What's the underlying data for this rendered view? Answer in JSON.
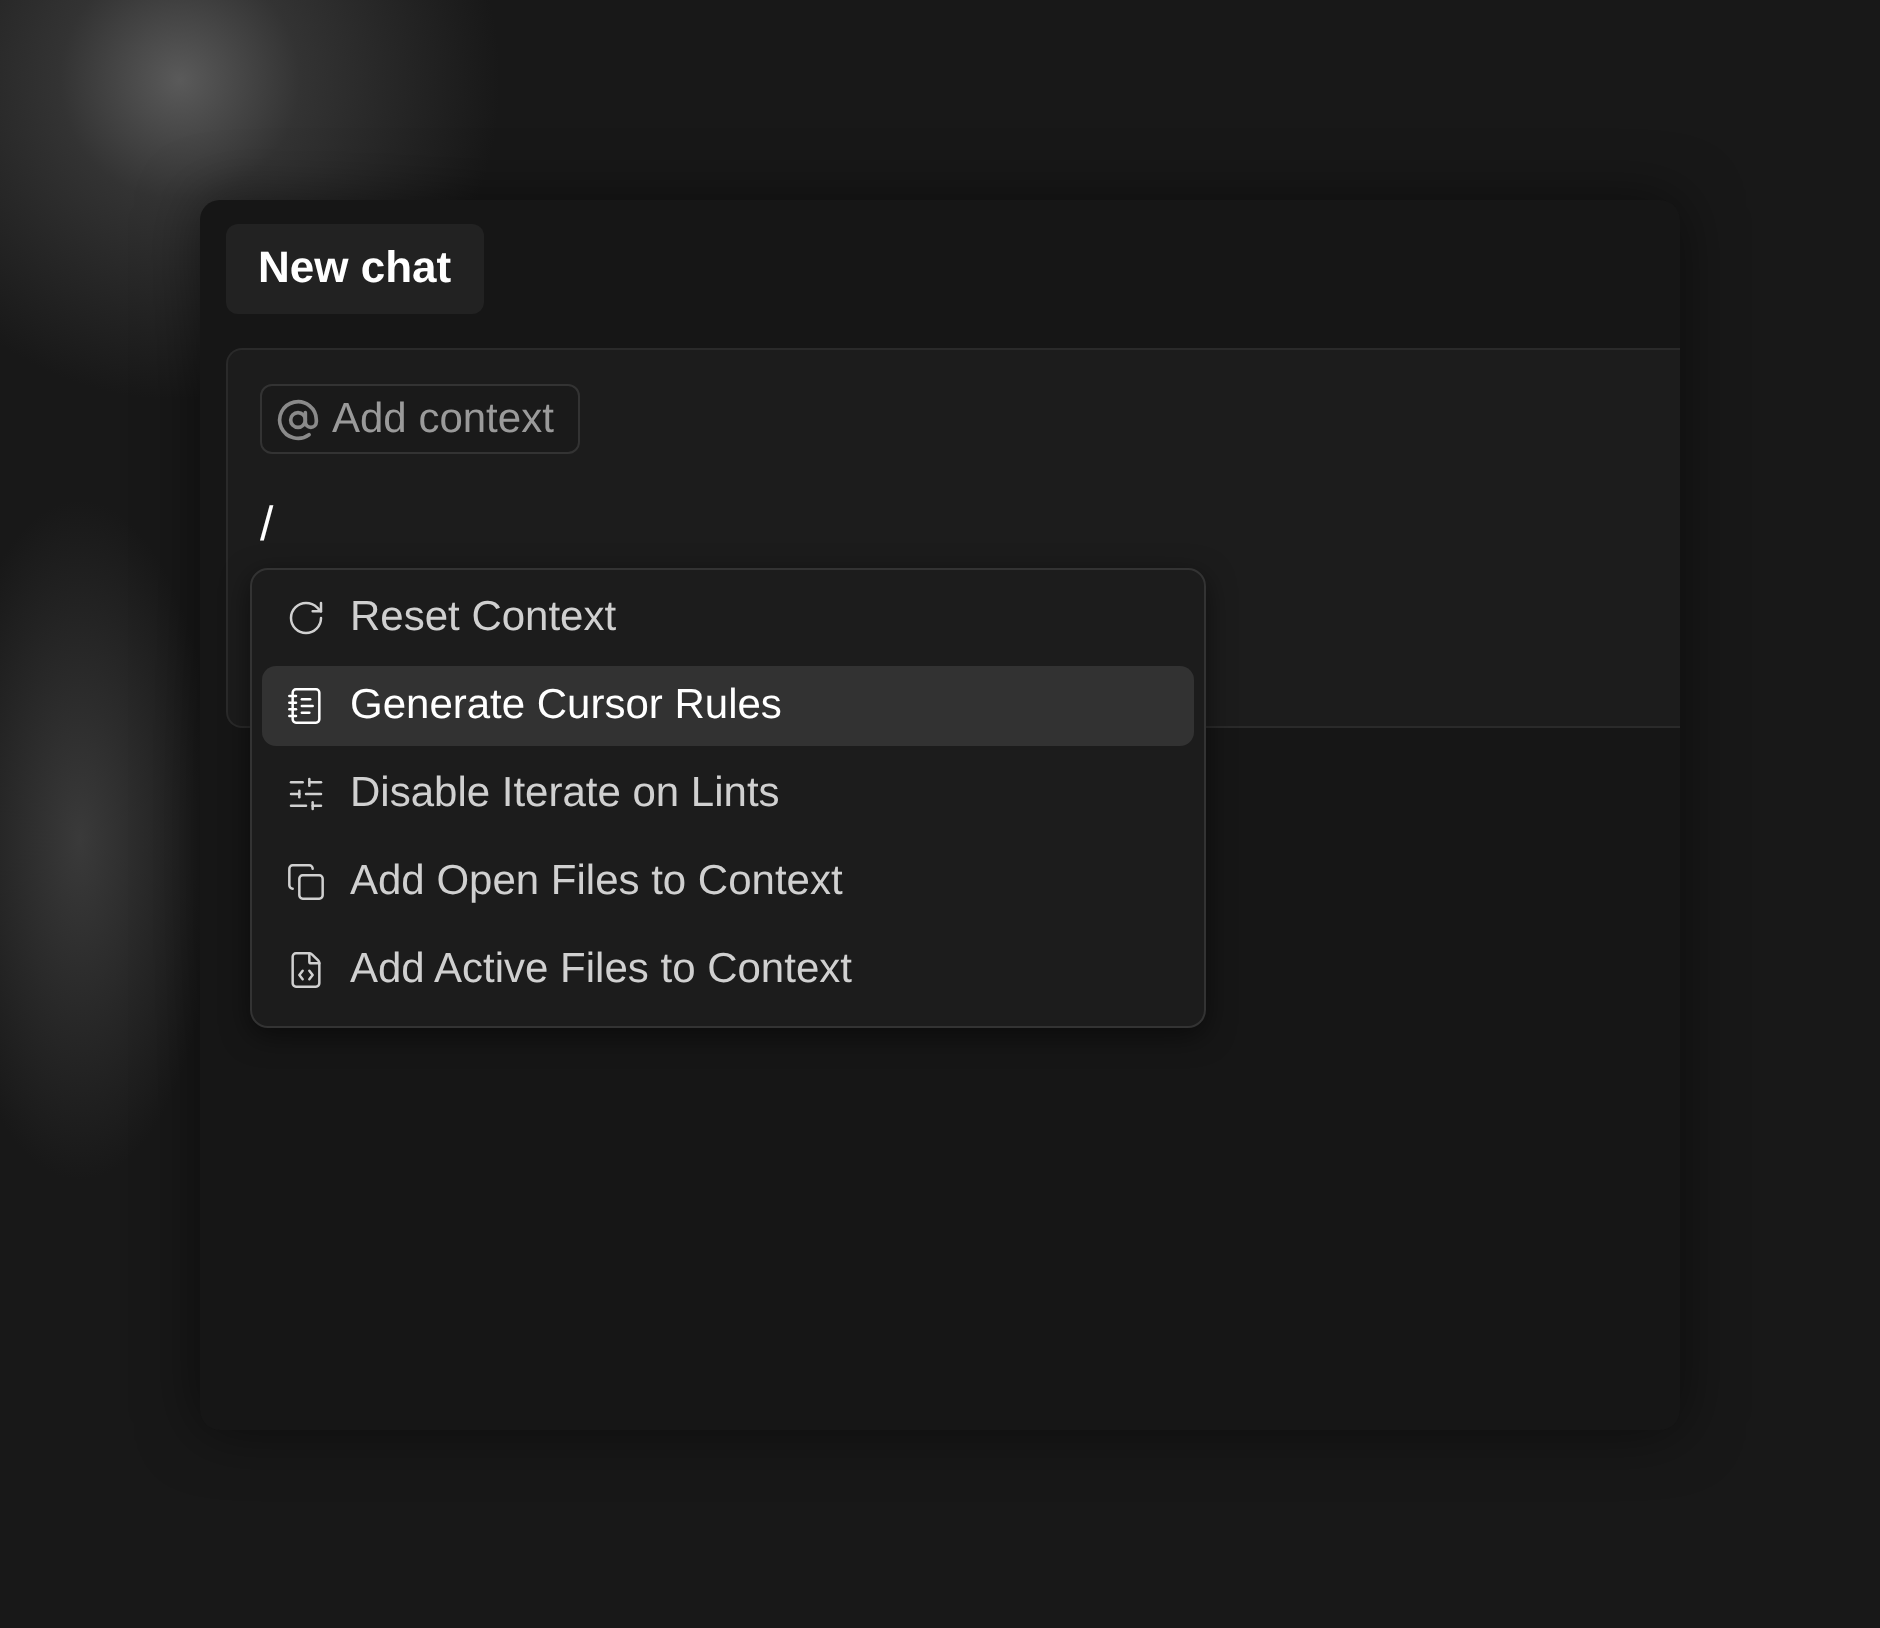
{
  "tab": {
    "label": "New chat",
    "selected": true
  },
  "composer": {
    "context_chip": "Add context",
    "value": "/"
  },
  "menu": {
    "items": [
      {
        "label": "Reset Context",
        "selected": false
      },
      {
        "label": "Generate Cursor Rules",
        "selected": true
      },
      {
        "label": "Disable Iterate on Lints",
        "selected": false
      },
      {
        "label": "Add Open Files to Context",
        "selected": false
      },
      {
        "label": "Add Active Files to Context",
        "selected": false
      }
    ]
  }
}
